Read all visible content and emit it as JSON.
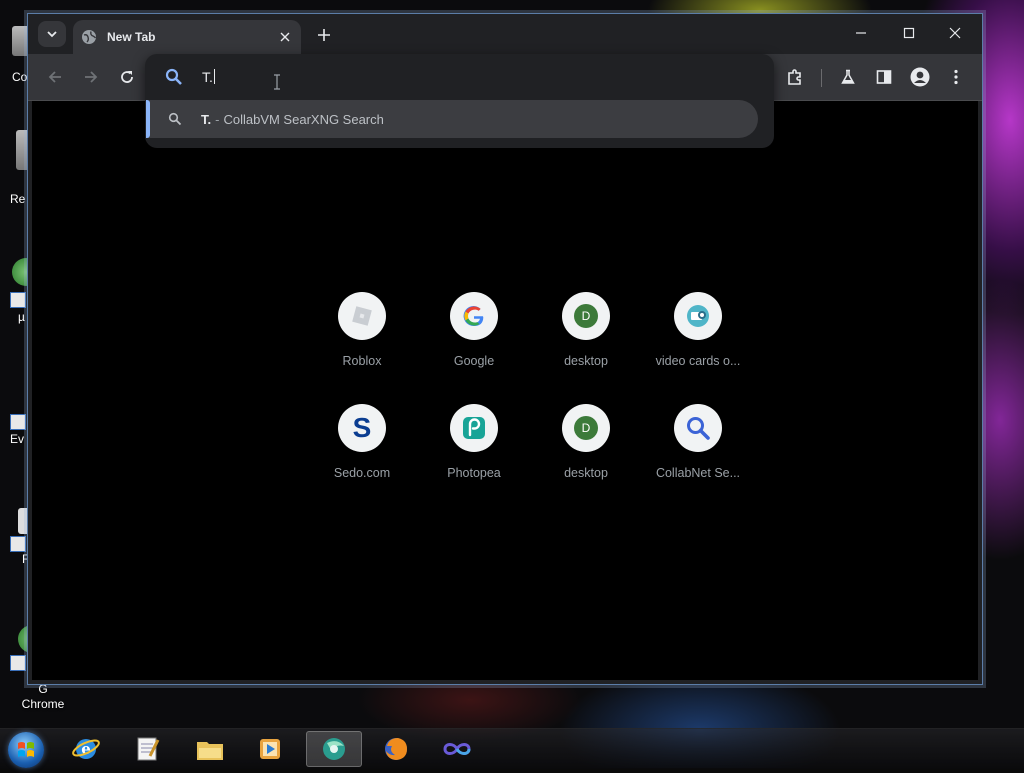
{
  "desktop": {
    "icon_labels": [
      "Co",
      "Re",
      "µ",
      "Ev",
      "F",
      "G",
      "Chrome"
    ]
  },
  "browser": {
    "tab": {
      "title": "New Tab"
    },
    "omnibox": {
      "value": "T.",
      "suggestion": {
        "query": "T.",
        "separator": "-",
        "provider": "CollabVM SearXNG Search"
      }
    },
    "shortcuts": [
      {
        "label": "Roblox",
        "icon": "roblox-icon"
      },
      {
        "label": "Google",
        "icon": "google-icon"
      },
      {
        "label": "desktop",
        "icon": "letter-d-icon",
        "letter": "D"
      },
      {
        "label": "video cards o...",
        "icon": "video-cards-icon"
      },
      {
        "label": "Sedo.com",
        "icon": "sedo-icon",
        "letter": "S"
      },
      {
        "label": "Photopea",
        "icon": "photopea-icon"
      },
      {
        "label": "desktop",
        "icon": "letter-d-icon",
        "letter": "D"
      },
      {
        "label": "CollabNet Se...",
        "icon": "magnifier-icon"
      }
    ]
  },
  "taskbar": {
    "apps": [
      "internet-explorer",
      "notepad",
      "file-explorer",
      "media-player",
      "chrome",
      "firefox",
      "infinity-app"
    ]
  },
  "colors": {
    "accent": "#8ab4f8",
    "desktop_tile_green": "#3c7a3a",
    "sedo_blue": "#0b3d91"
  }
}
